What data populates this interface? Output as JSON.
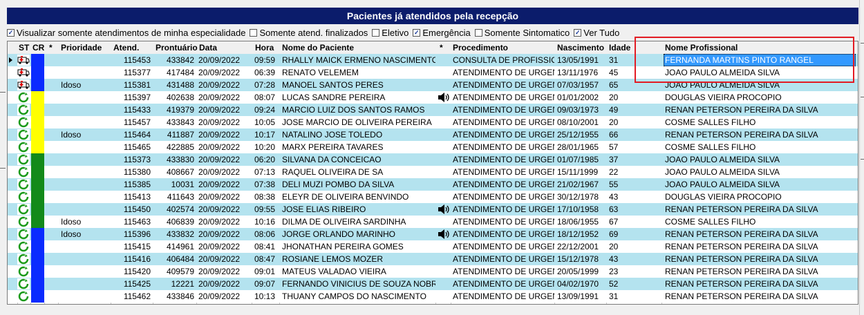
{
  "title": "Pacientes já atendidos pela recepção",
  "filters": [
    {
      "label": "Visualizar somente atendimentos de minha especialidade",
      "checked": true
    },
    {
      "label": "Somente atend. finalizados",
      "checked": false
    },
    {
      "label": "Eletivo",
      "checked": false
    },
    {
      "label": "Emergência",
      "checked": true
    },
    {
      "label": "Somente Sintomatico",
      "checked": false
    },
    {
      "label": "Ver Tudo",
      "checked": true
    }
  ],
  "columns": {
    "st": "ST",
    "cr": "CR",
    "star1": "*",
    "prioridade": "Prioridade",
    "atend": "Atend.",
    "prontuario": "Prontuário",
    "data": "Data",
    "hora": "Hora",
    "nome": "Nome do Paciente",
    "star2": "*",
    "procedimento": "Procedimento",
    "nascimento": "Nascimento",
    "idade": "Idade",
    "profissional": "Nome Profissional"
  },
  "colors": {
    "title_bg": "#0b1c6b",
    "row_alt": "#b4e3ef",
    "blue": "#0a2bff",
    "yellow": "#ffff00",
    "green": "#138a1a",
    "highlight": "#e31b23",
    "selection": "#3399ff"
  },
  "rows": [
    {
      "st": "ambulance-icon",
      "cr": "blue",
      "prioridade": "",
      "atend": "115453",
      "prontuario": "433842",
      "data": "20/09/2022",
      "hora": "09:59",
      "nome": "RHALLY MAICK ERMENO NASCIMENTO",
      "audio": false,
      "procedimento": "CONSULTA DE PROFISSIONAL",
      "nascimento": "13/05/1991",
      "idade": "31",
      "profissional": "FERNANDA MARTINS PINTO RANGEL",
      "selected": true
    },
    {
      "st": "ambulance-icon",
      "cr": "blue",
      "prioridade": "",
      "atend": "115377",
      "prontuario": "417484",
      "data": "20/09/2022",
      "hora": "06:39",
      "nome": "RENATO VELEMEM",
      "audio": false,
      "procedimento": "ATENDIMENTO DE URGENCIA",
      "nascimento": "13/11/1976",
      "idade": "45",
      "profissional": "JOAO PAULO ALMEIDA SILVA",
      "selected": false
    },
    {
      "st": "ambulance-icon",
      "cr": "blue",
      "prioridade": "Idoso",
      "atend": "115381",
      "prontuario": "431488",
      "data": "20/09/2022",
      "hora": "07:28",
      "nome": "MANOEL SANTOS PERES",
      "audio": false,
      "procedimento": "ATENDIMENTO DE URGENCIA",
      "nascimento": "07/03/1957",
      "idade": "65",
      "profissional": "JOAO PAULO ALMEIDA SILVA",
      "selected": false
    },
    {
      "st": "refresh-icon",
      "cr": "yellow",
      "prioridade": "",
      "atend": "115397",
      "prontuario": "402638",
      "data": "20/09/2022",
      "hora": "08:07",
      "nome": "LUCAS SANDRE PEREIRA",
      "audio": true,
      "procedimento": "ATENDIMENTO DE URGENCIA",
      "nascimento": "01/01/2002",
      "idade": "20",
      "profissional": "DOUGLAS VIEIRA PROCOPIO",
      "selected": false
    },
    {
      "st": "refresh-icon",
      "cr": "yellow",
      "prioridade": "",
      "atend": "115433",
      "prontuario": "419379",
      "data": "20/09/2022",
      "hora": "09:24",
      "nome": "MARCIO LUIZ DOS SANTOS RAMOS",
      "audio": false,
      "procedimento": "ATENDIMENTO DE URGENCIA",
      "nascimento": "09/03/1973",
      "idade": "49",
      "profissional": "RENAN PETERSON PEREIRA DA SILVA",
      "selected": false
    },
    {
      "st": "refresh-icon",
      "cr": "yellow",
      "prioridade": "",
      "atend": "115457",
      "prontuario": "433843",
      "data": "20/09/2022",
      "hora": "10:05",
      "nome": "JOSE MARCIO DE OLIVEIRA PEREIRA",
      "audio": false,
      "procedimento": "ATENDIMENTO DE URGENCIA",
      "nascimento": "08/10/2001",
      "idade": "20",
      "profissional": "COSME SALLES FILHO",
      "selected": false
    },
    {
      "st": "refresh-icon",
      "cr": "yellow",
      "prioridade": "Idoso",
      "atend": "115464",
      "prontuario": "411887",
      "data": "20/09/2022",
      "hora": "10:17",
      "nome": "NATALINO JOSE TOLEDO",
      "audio": false,
      "procedimento": "ATENDIMENTO DE URGENCIA",
      "nascimento": "25/12/1955",
      "idade": "66",
      "profissional": "RENAN PETERSON PEREIRA DA SILVA",
      "selected": false
    },
    {
      "st": "refresh-icon",
      "cr": "yellow",
      "prioridade": "",
      "atend": "115465",
      "prontuario": "422885",
      "data": "20/09/2022",
      "hora": "10:20",
      "nome": "MARX PEREIRA TAVARES",
      "audio": false,
      "procedimento": "ATENDIMENTO DE URGENCIA",
      "nascimento": "28/01/1965",
      "idade": "57",
      "profissional": "COSME SALLES FILHO",
      "selected": false
    },
    {
      "st": "refresh-icon",
      "cr": "green",
      "prioridade": "",
      "atend": "115373",
      "prontuario": "433830",
      "data": "20/09/2022",
      "hora": "06:20",
      "nome": "SILVANA DA CONCEICAO",
      "audio": false,
      "procedimento": "ATENDIMENTO DE URGENCIA",
      "nascimento": "01/07/1985",
      "idade": "37",
      "profissional": "JOAO PAULO ALMEIDA SILVA",
      "selected": false
    },
    {
      "st": "refresh-icon",
      "cr": "green",
      "prioridade": "",
      "atend": "115380",
      "prontuario": "408667",
      "data": "20/09/2022",
      "hora": "07:13",
      "nome": "RAQUEL OLIVEIRA DE SA",
      "audio": false,
      "procedimento": "ATENDIMENTO DE URGENCIA",
      "nascimento": "15/11/1999",
      "idade": "22",
      "profissional": "JOAO PAULO ALMEIDA SILVA",
      "selected": false
    },
    {
      "st": "refresh-icon",
      "cr": "green",
      "prioridade": "",
      "atend": "115385",
      "prontuario": "10031",
      "data": "20/09/2022",
      "hora": "07:38",
      "nome": "DELI MUZI POMBO DA SILVA",
      "audio": false,
      "procedimento": "ATENDIMENTO DE URGENCIA",
      "nascimento": "21/02/1967",
      "idade": "55",
      "profissional": "JOAO PAULO ALMEIDA SILVA",
      "selected": false
    },
    {
      "st": "refresh-icon",
      "cr": "green",
      "prioridade": "",
      "atend": "115413",
      "prontuario": "411643",
      "data": "20/09/2022",
      "hora": "08:38",
      "nome": "ELEYR DE OLIVEIRA BENVINDO",
      "audio": false,
      "procedimento": "ATENDIMENTO DE URGENCIA",
      "nascimento": "30/12/1978",
      "idade": "43",
      "profissional": "DOUGLAS VIEIRA PROCOPIO",
      "selected": false
    },
    {
      "st": "refresh-icon",
      "cr": "green",
      "prioridade": "",
      "atend": "115450",
      "prontuario": "402574",
      "data": "20/09/2022",
      "hora": "09:55",
      "nome": "JOSE ELIAS RIBEIRO",
      "audio": true,
      "procedimento": "ATENDIMENTO DE URGENCIA",
      "nascimento": "17/10/1958",
      "idade": "63",
      "profissional": "RENAN PETERSON PEREIRA DA SILVA",
      "selected": false
    },
    {
      "st": "refresh-icon",
      "cr": "green",
      "prioridade": "Idoso",
      "atend": "115463",
      "prontuario": "406839",
      "data": "20/09/2022",
      "hora": "10:16",
      "nome": "DILMA DE OLIVEIRA SARDINHA",
      "audio": false,
      "procedimento": "ATENDIMENTO DE URGENCIA",
      "nascimento": "18/06/1955",
      "idade": "67",
      "profissional": "COSME SALLES FILHO",
      "selected": false
    },
    {
      "st": "refresh-icon",
      "cr": "blue",
      "prioridade": "Idoso",
      "atend": "115396",
      "prontuario": "433832",
      "data": "20/09/2022",
      "hora": "08:06",
      "nome": "JORGE ORLANDO MARINHO",
      "audio": true,
      "procedimento": "ATENDIMENTO DE URGENCIA",
      "nascimento": "18/12/1952",
      "idade": "69",
      "profissional": "RENAN PETERSON PEREIRA DA SILVA",
      "selected": false
    },
    {
      "st": "refresh-icon",
      "cr": "blue",
      "prioridade": "",
      "atend": "115415",
      "prontuario": "414961",
      "data": "20/09/2022",
      "hora": "08:41",
      "nome": "JHONATHAN PEREIRA GOMES",
      "audio": false,
      "procedimento": "ATENDIMENTO DE URGENCIA",
      "nascimento": "22/12/2001",
      "idade": "20",
      "profissional": "RENAN PETERSON PEREIRA DA SILVA",
      "selected": false
    },
    {
      "st": "refresh-icon",
      "cr": "blue",
      "prioridade": "",
      "atend": "115416",
      "prontuario": "406484",
      "data": "20/09/2022",
      "hora": "08:47",
      "nome": "ROSIANE LEMOS MOZER",
      "audio": false,
      "procedimento": "ATENDIMENTO DE URGENCIA",
      "nascimento": "15/12/1978",
      "idade": "43",
      "profissional": "RENAN PETERSON PEREIRA DA SILVA",
      "selected": false
    },
    {
      "st": "refresh-icon",
      "cr": "blue",
      "prioridade": "",
      "atend": "115420",
      "prontuario": "409579",
      "data": "20/09/2022",
      "hora": "09:01",
      "nome": "MATEUS VALADAO VIEIRA",
      "audio": false,
      "procedimento": "ATENDIMENTO DE URGENCIA",
      "nascimento": "20/05/1999",
      "idade": "23",
      "profissional": "RENAN PETERSON PEREIRA DA SILVA",
      "selected": false
    },
    {
      "st": "refresh-icon",
      "cr": "blue",
      "prioridade": "",
      "atend": "115425",
      "prontuario": "12221",
      "data": "20/09/2022",
      "hora": "09:07",
      "nome": "FERNANDO VINICIUS DE SOUZA NOBRE",
      "audio": false,
      "procedimento": "ATENDIMENTO DE URGENCIA",
      "nascimento": "04/02/1970",
      "idade": "52",
      "profissional": "RENAN PETERSON PEREIRA DA SILVA",
      "selected": false
    },
    {
      "st": "refresh-icon",
      "cr": "blue",
      "prioridade": "",
      "atend": "115462",
      "prontuario": "433846",
      "data": "20/09/2022",
      "hora": "10:13",
      "nome": "THUANY CAMPOS DO NASCIMENTO",
      "audio": false,
      "procedimento": "ATENDIMENTO DE URGENCIA",
      "nascimento": "13/09/1991",
      "idade": "31",
      "profissional": "RENAN PETERSON PEREIRA DA SILVA",
      "selected": false
    }
  ]
}
